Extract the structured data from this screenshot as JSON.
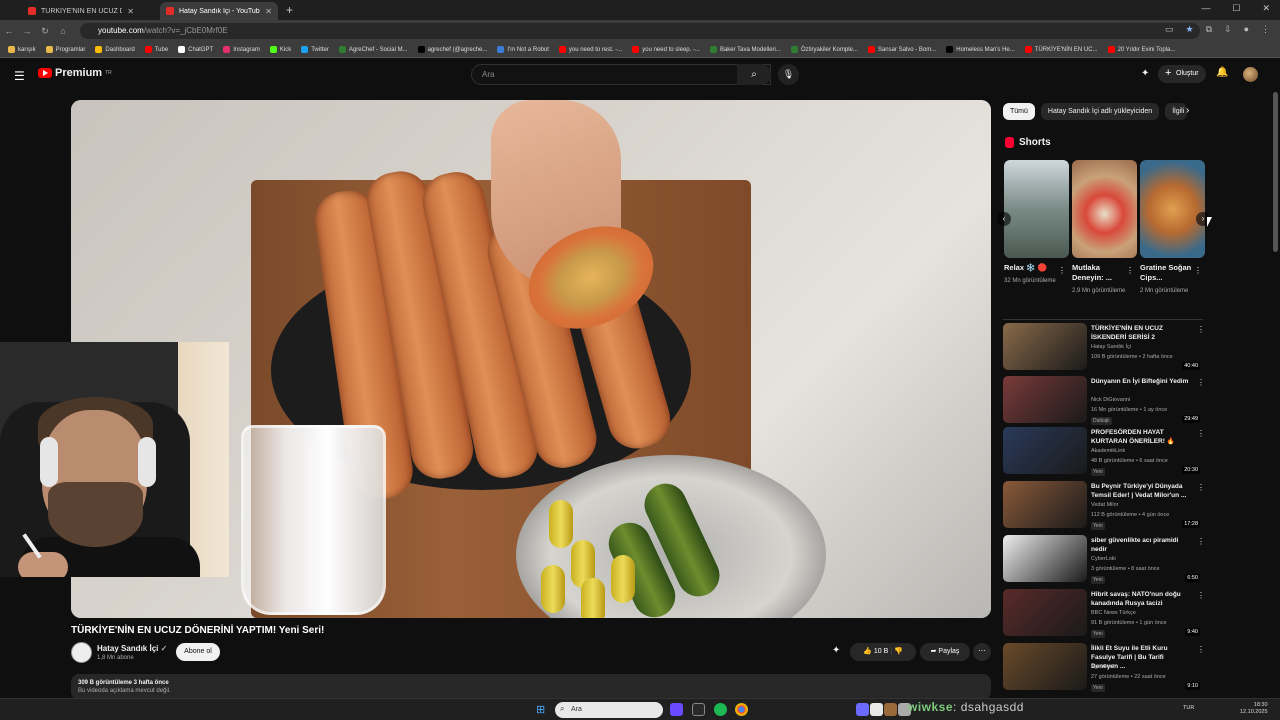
{
  "browser": {
    "tabs": [
      {
        "title": "TÜRKİYE'NİN EN UCUZ DÖNERİ",
        "active": false
      },
      {
        "title": "Hatay Sandık İçi - YouTube",
        "active": true
      }
    ],
    "url_host": "youtube.com",
    "url_path": "/watch?v=_jCbE0Mrf0E",
    "bookmarks": [
      "karışık",
      "Programlar",
      "Dashboard",
      "Tube",
      "ChatGPT",
      "Instagram",
      "Kick",
      "Twitter",
      "AgreChef - Social M...",
      "agrechef (@agreche...",
      "I'm Not a Robot",
      "you need to rest. -...",
      "you need to sleep. -...",
      "Baker Tava Modelleri...",
      "Öztiryakiler Komple...",
      "Sansar Salvo - Bom...",
      "Homeless Man's He...",
      "TÜRKİYE'NİN EN UC...",
      "20 Yıldır Evini Topla..."
    ]
  },
  "youtube": {
    "logo": "Premium",
    "logo_sup": "TR",
    "search_placeholder": "Ara",
    "create_label": "Oluştur"
  },
  "video": {
    "title": "TÜRKİYE'NİN EN UCUZ DÖNERİNİ YAPTIM! Yeni Seri!",
    "channel": "Hatay Sandık İçi",
    "subscribers": "1,8 Mn abone",
    "subscribe_label": "Abone ol",
    "likes": "10 B",
    "share_label": "Paylaş",
    "views_line": "309 B görüntüleme  3 hafta önce",
    "desc_line": "Bu videoda açıklama mevcut değil."
  },
  "sidebar": {
    "chips": [
      "Tümü",
      "Hatay Sandık İçi adlı yükleyiciden",
      "İlgili"
    ],
    "shorts_title": "Shorts",
    "shorts": [
      {
        "title": "Relax ❄️ 🛑",
        "views": "32 Mn görüntüleme"
      },
      {
        "title": "Mutlaka Deneyin: ...",
        "views": "2,9 Mn görüntüleme"
      },
      {
        "title": "Gratine Soğan Cips...",
        "views": "2 Mn görüntüleme"
      }
    ],
    "recs": [
      {
        "title": "TÜRKİYE'NİN EN UCUZ İSKENDERİ SERİSİ 2",
        "channel": "Hatay Sandık İçi",
        "meta": "109 B görüntüleme • 2 hafta önce",
        "badge": "",
        "duration": "40:40",
        "thumb": "#8a6a4a"
      },
      {
        "title": "Dünyanın En İyi Bifteğini Yedim",
        "channel": "Nick DiGiovanni",
        "meta": "16 Mn görüntüleme • 1 ay önce",
        "badge": "Dublajlı",
        "duration": "29:49",
        "thumb": "#7a3a3a"
      },
      {
        "title": "PROFESÖRDEN HAYAT KURTARAN ÖNERİLER! 🔥",
        "channel": "AkademikLink",
        "meta": "48 B görüntüleme • 6 saat önce",
        "badge": "Yeni",
        "duration": "20:30",
        "thumb": "#2a3a5a"
      },
      {
        "title": "Bu Peynir Türkiye'yi Dünyada Temsil Eder! | Vedat Milor'un ...",
        "channel": "Vedat Milor",
        "meta": "112 B görüntüleme • 4 gün önce",
        "badge": "Yeni",
        "duration": "17:28",
        "thumb": "#8a5a3a"
      },
      {
        "title": "siber güvenlikte acı piramidi nedir",
        "channel": "CyberLoki",
        "meta": "3 görüntüleme • 8 saat önce",
        "badge": "Yeni",
        "duration": "6:50",
        "thumb": "#eeeeee"
      },
      {
        "title": "Hibrit savaş: NATO'nun doğu kanadında Rusya tacizi",
        "channel": "BBC News Türkçe",
        "meta": "91 B görüntüleme • 1 gün önce",
        "badge": "Yeni",
        "duration": "9:40",
        "thumb": "#5a2a2a"
      },
      {
        "title": "İlikli Et Suyu ile Etli Kuru Fasulye Tarifi | Bu Tarifi Deneyen ...",
        "channel": "AgreChef",
        "meta": "27 görüntüleme • 22 saat önce",
        "badge": "Yeni",
        "duration": "9:10",
        "thumb": "#6a4a2a"
      }
    ]
  },
  "taskbar": {
    "search": "Ara",
    "lang": "TUR",
    "time": "18:30",
    "date": "12.10.2025",
    "overlay_text": "wiwkse",
    "overlay_text2": ": dsahgasdd"
  }
}
